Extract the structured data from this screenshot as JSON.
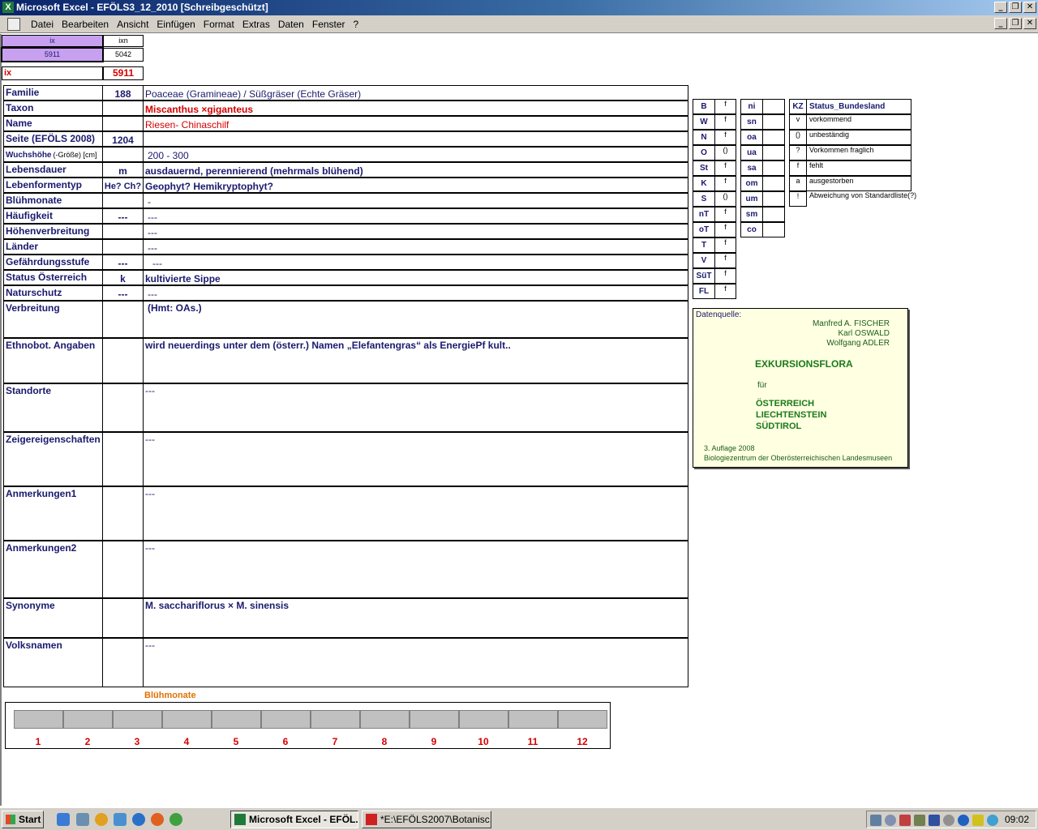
{
  "window": {
    "title": "Microsoft Excel - EFÖLS3_12_2010  [Schreibgeschützt]",
    "controls": [
      "_",
      "❐",
      "✕"
    ]
  },
  "menu": [
    "Datei",
    "Bearbeiten",
    "Ansicht",
    "Einfügen",
    "Format",
    "Extras",
    "Daten",
    "Fenster",
    "?"
  ],
  "index": {
    "ix_header": "ix",
    "ixn_header": "ixn",
    "ix_value": "5911",
    "ixn_value": "5042",
    "ix_label": "ix",
    "ix_big": "5911"
  },
  "rows": [
    {
      "label": "Familie",
      "code": "188",
      "text": "Poaceae (Gramineae)  /  Süßgräser (Echte Gräser)"
    },
    {
      "label": "Taxon",
      "code": "",
      "text": "Miscanthus ×giganteus"
    },
    {
      "label": "Name",
      "code": "",
      "text": "Riesen- Chinaschilf"
    },
    {
      "label": "Seite (EFÖLS 2008)",
      "code": "1204",
      "text": ""
    },
    {
      "label": "Wuchshöhe",
      "label_suffix": "(-Größe) [cm]",
      "code": "",
      "text": "200 - 300"
    },
    {
      "label": "Lebensdauer",
      "code": "m",
      "text": "ausdauernd, perennierend (mehrmals blühend)"
    },
    {
      "label": "Lebenformentyp",
      "code": "He? Ch?",
      "text": "Geophyt? Hemikryptophyt?"
    },
    {
      "label": "Blühmonate",
      "code": "",
      "text": "-"
    },
    {
      "label": "Häufigkeit",
      "code": "---",
      "text": "---"
    },
    {
      "label": "Höhenverbreitung",
      "code": "",
      "text": "---"
    },
    {
      "label": "Länder",
      "code": "",
      "text": "---"
    },
    {
      "label": "Gefährdungsstufe",
      "code": "---",
      "text": "---"
    },
    {
      "label": "Status Österreich",
      "code": "k",
      "text": "kultivierte Sippe"
    },
    {
      "label": "Naturschutz",
      "code": "---",
      "text": "---"
    },
    {
      "label": "Verbreitung",
      "code": "",
      "text": "(Hmt: OAs.)"
    },
    {
      "label": "Ethnobot. Angaben",
      "code": "",
      "text": "wird neuerdings unter dem (österr.) Namen „Elefantengras“ als EnergiePf kult.."
    },
    {
      "label": "Standorte",
      "code": "",
      "text": "---"
    },
    {
      "label": "Zeigereigenschaften",
      "code": "",
      "text": "---"
    },
    {
      "label": "Anmerkungen1",
      "code": "",
      "text": "---"
    },
    {
      "label": "Anmerkungen2",
      "code": "",
      "text": "---"
    },
    {
      "label": "Synonyme",
      "code": "",
      "text": "M. sacchariflorus × M. sinensis"
    },
    {
      "label": "Volksnamen",
      "code": "",
      "text": "---"
    }
  ],
  "region_table": {
    "left": [
      {
        "k": "B",
        "v": "f"
      },
      {
        "k": "W",
        "v": "f"
      },
      {
        "k": "N",
        "v": "f"
      },
      {
        "k": "O",
        "v": "()"
      },
      {
        "k": "St",
        "v": "f"
      },
      {
        "k": "K",
        "v": "f"
      },
      {
        "k": "S",
        "v": "()"
      },
      {
        "k": "nT",
        "v": "f"
      },
      {
        "k": "oT",
        "v": "f"
      },
      {
        "k": "T",
        "v": "f"
      },
      {
        "k": "V",
        "v": "f"
      },
      {
        "k": "SüT",
        "v": "f"
      },
      {
        "k": "FL",
        "v": "f"
      }
    ],
    "mid": [
      {
        "k": "ni",
        "v": ""
      },
      {
        "k": "sn",
        "v": ""
      },
      {
        "k": "oa",
        "v": ""
      },
      {
        "k": "ua",
        "v": ""
      },
      {
        "k": "sa",
        "v": ""
      },
      {
        "k": "om",
        "v": ""
      },
      {
        "k": "um",
        "v": ""
      },
      {
        "k": "sm",
        "v": ""
      },
      {
        "k": "co",
        "v": ""
      }
    ]
  },
  "status_legend": {
    "header_kz": "KZ",
    "header_status": "Status_Bundesland",
    "items": [
      {
        "kz": "v",
        "text": "vorkommend"
      },
      {
        "kz": "()",
        "text": "unbeständig"
      },
      {
        "kz": "?",
        "text": "Vorkommen fraglich"
      },
      {
        "kz": "f",
        "text": "fehlt"
      },
      {
        "kz": "a",
        "text": "ausgestorben"
      },
      {
        "kz": "!",
        "text": "Abweichung von Standardliste(?)"
      }
    ]
  },
  "datenquelle": {
    "label": "Datenquelle:",
    "authors": [
      "Manfred A. FISCHER",
      "Karl OSWALD",
      "Wolfgang ADLER"
    ],
    "book_title": "EXKURSIONSFLORA",
    "fuer": "für",
    "countries": [
      "ÖSTERREICH",
      "LIECHTENSTEIN",
      "SÜDTIROL"
    ],
    "edition": "3. Auflage 2008",
    "publisher": "Biologiezentrum der Oberösterreichischen Landesmuseen"
  },
  "bluehmonate": {
    "title": "Blühmonate",
    "months": [
      "1",
      "2",
      "3",
      "4",
      "5",
      "6",
      "7",
      "8",
      "9",
      "10",
      "11",
      "12"
    ]
  },
  "taskbar": {
    "start": "Start",
    "items": [
      "Microsoft Excel - EFÖL...",
      "*E:\\EFÖLS2007\\Botanisc..."
    ],
    "clock": "09:02"
  }
}
